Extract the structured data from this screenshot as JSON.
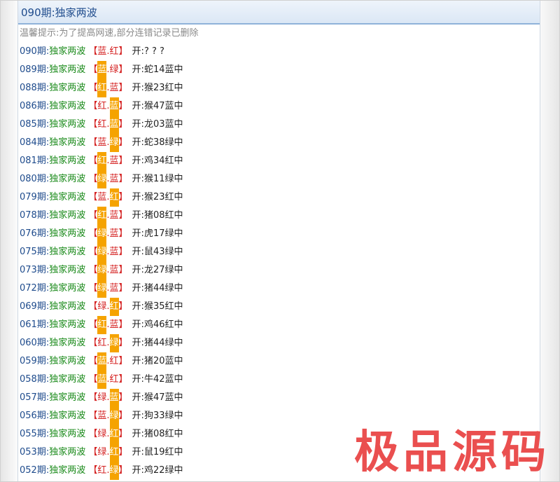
{
  "header": {
    "title": "090期:独家两波"
  },
  "tip": "温馨提示:为了提高网速,部分连错记录已删除",
  "game_name": "独家两波",
  "open_prefix": "开:",
  "rows": [
    {
      "num": "090期:",
      "c1": "蓝",
      "c2": "红",
      "hl": 0,
      "res": "? ? ?"
    },
    {
      "num": "089期:",
      "c1": "蓝",
      "c2": "绿",
      "hl": 1,
      "res": "蛇14蓝中"
    },
    {
      "num": "088期:",
      "c1": "红",
      "c2": "蓝",
      "hl": 1,
      "res": "猴23红中"
    },
    {
      "num": "086期:",
      "c1": "红",
      "c2": "蓝",
      "hl": 2,
      "res": "猴47蓝中"
    },
    {
      "num": "085期:",
      "c1": "红",
      "c2": "蓝",
      "hl": 2,
      "res": "龙03蓝中"
    },
    {
      "num": "084期:",
      "c1": "蓝",
      "c2": "绿",
      "hl": 2,
      "res": "蛇38绿中"
    },
    {
      "num": "081期:",
      "c1": "红",
      "c2": "蓝",
      "hl": 1,
      "res": "鸡34红中"
    },
    {
      "num": "080期:",
      "c1": "绿",
      "c2": "蓝",
      "hl": 1,
      "res": "猴11绿中"
    },
    {
      "num": "079期:",
      "c1": "蓝",
      "c2": "红",
      "hl": 2,
      "res": "猴23红中"
    },
    {
      "num": "078期:",
      "c1": "红",
      "c2": "蓝",
      "hl": 1,
      "res": "猪08红中"
    },
    {
      "num": "076期:",
      "c1": "绿",
      "c2": "蓝",
      "hl": 1,
      "res": "虎17绿中"
    },
    {
      "num": "075期:",
      "c1": "绿",
      "c2": "蓝",
      "hl": 1,
      "res": "鼠43绿中"
    },
    {
      "num": "073期:",
      "c1": "绿",
      "c2": "蓝",
      "hl": 1,
      "res": "龙27绿中"
    },
    {
      "num": "072期:",
      "c1": "绿",
      "c2": "蓝",
      "hl": 1,
      "res": "猪44绿中"
    },
    {
      "num": "069期:",
      "c1": "绿",
      "c2": "红",
      "hl": 2,
      "res": "猴35红中"
    },
    {
      "num": "061期:",
      "c1": "红",
      "c2": "蓝",
      "hl": 1,
      "res": "鸡46红中"
    },
    {
      "num": "060期:",
      "c1": "红",
      "c2": "绿",
      "hl": 2,
      "res": "猪44绿中"
    },
    {
      "num": "059期:",
      "c1": "蓝",
      "c2": "红",
      "hl": 1,
      "res": "猪20蓝中"
    },
    {
      "num": "058期:",
      "c1": "蓝",
      "c2": "红",
      "hl": 1,
      "res": "牛42蓝中"
    },
    {
      "num": "057期:",
      "c1": "绿",
      "c2": "蓝",
      "hl": 2,
      "res": "猴47蓝中"
    },
    {
      "num": "056期:",
      "c1": "蓝",
      "c2": "绿",
      "hl": 2,
      "res": "狗33绿中"
    },
    {
      "num": "055期:",
      "c1": "绿",
      "c2": "红",
      "hl": 2,
      "res": "猪08红中"
    },
    {
      "num": "053期:",
      "c1": "绿",
      "c2": "红",
      "hl": 2,
      "res": "鼠19红中"
    },
    {
      "num": "052期:",
      "c1": "红",
      "c2": "绿",
      "hl": 2,
      "res": "鸡22绿中"
    }
  ],
  "watermark": "极品源码"
}
